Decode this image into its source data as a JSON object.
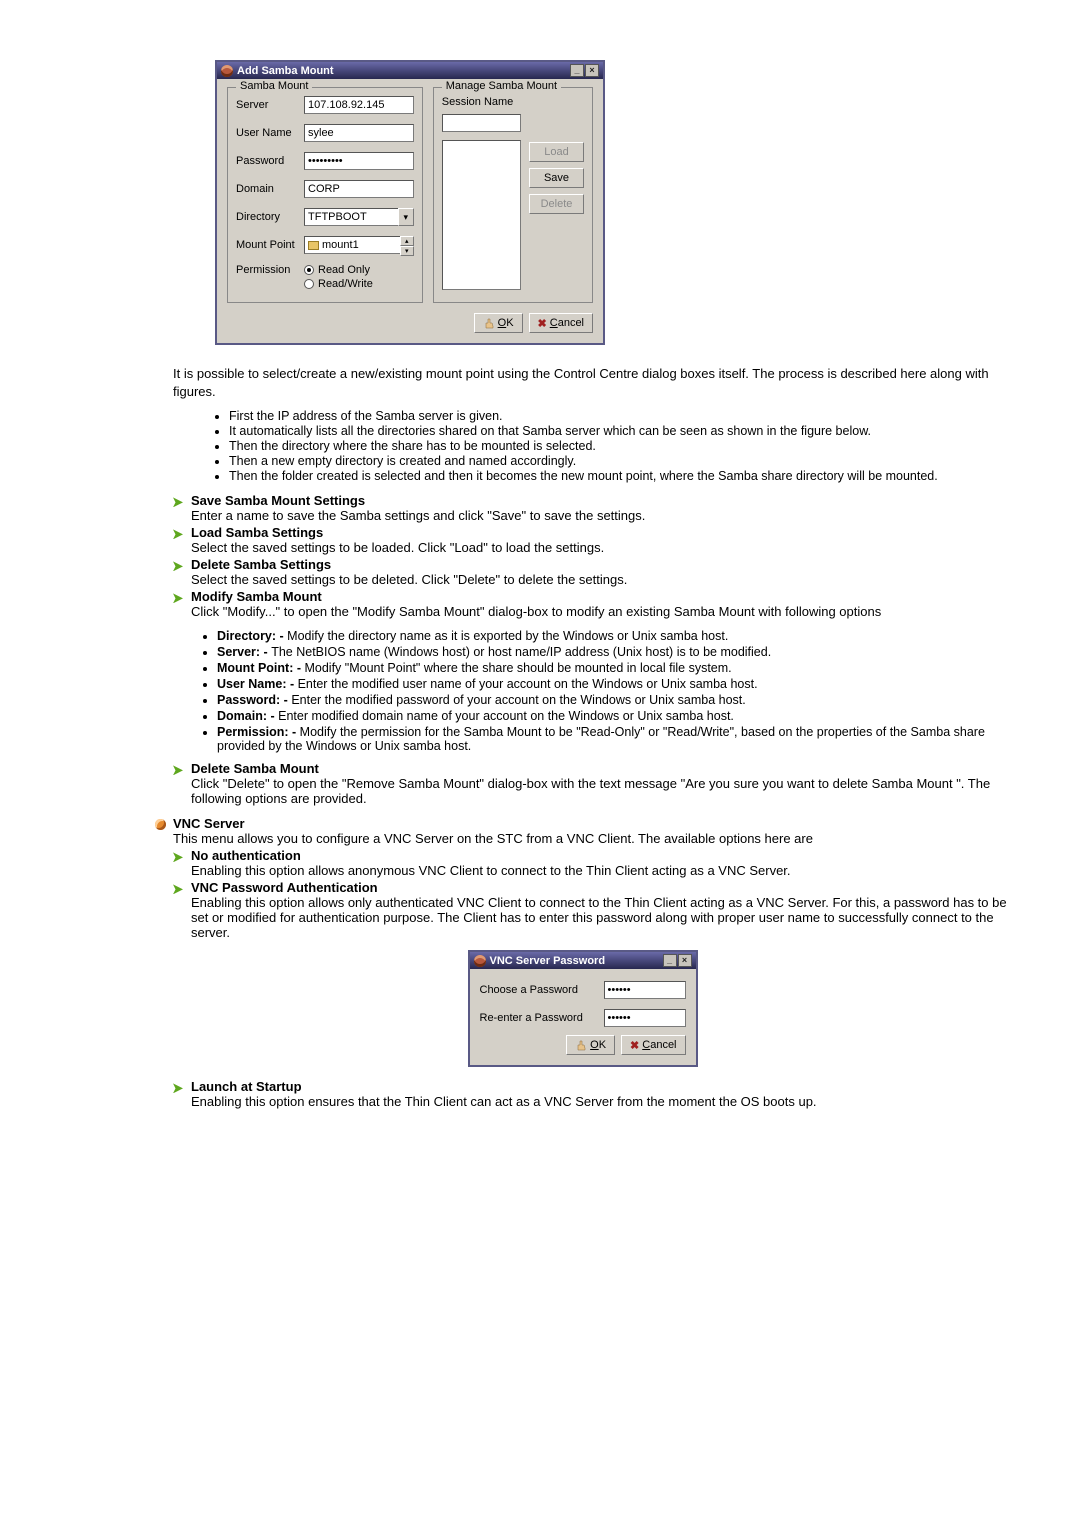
{
  "dialog1": {
    "title": "Add Samba Mount",
    "group_left_title": "Samba Mount",
    "group_right_title": "Manage Samba Mount",
    "labels": {
      "server": "Server",
      "username": "User Name",
      "password": "Password",
      "domain": "Domain",
      "directory": "Directory",
      "mountpoint": "Mount Point",
      "permission": "Permission",
      "session_name": "Session Name"
    },
    "values": {
      "server": "107.108.92.145",
      "username": "sylee",
      "password": "•••••••••",
      "domain": "CORP",
      "directory": "TFTPBOOT",
      "mountpoint": "mount1"
    },
    "radios": {
      "readonly": "Read Only",
      "readwrite": "Read/Write"
    },
    "buttons": {
      "load": "Load",
      "save": "Save",
      "delete": "Delete",
      "ok": "OK",
      "cancel": "Cancel"
    }
  },
  "doc_intro": "It is possible to select/create a new/existing mount point using the Control Centre dialog boxes itself. The process is described here along with figures.",
  "steps": [
    "First the IP address of the Samba server is given.",
    "It automatically lists all the directories shared on that Samba server which can be seen as shown in the figure below.",
    "Then the directory where the share has to be mounted is selected.",
    "Then a new empty directory is created and named accordingly.",
    "Then the folder created is selected and then it becomes the new mount point, where the Samba share directory will be mounted."
  ],
  "sections": {
    "save": {
      "title": "Save Samba Mount Settings",
      "body": "Enter a name to save the Samba settings and click \"Save\" to save the settings."
    },
    "load": {
      "title": "Load Samba Settings",
      "body": "Select the saved settings to be loaded. Click \"Load\" to load the settings."
    },
    "delset": {
      "title": "Delete Samba Settings",
      "body": "Select the saved settings to be deleted. Click \"Delete\" to delete the settings."
    },
    "modify": {
      "title": "Modify Samba Mount",
      "body": "Click \"Modify...\" to open the \"Modify Samba Mount\" dialog-box to modify an existing Samba Mount with following options"
    },
    "delmount": {
      "title": "Delete Samba Mount",
      "body": "Click \"Delete\" to open the \"Remove Samba Mount\" dialog-box with the text message \"Are you sure you want to delete Samba Mount \". The following options are provided."
    }
  },
  "modify_items": [
    {
      "label": "Directory: - ",
      "text": "Modify the directory name as it is exported by the Windows or Unix samba host."
    },
    {
      "label": "Server: - ",
      "text": "The NetBIOS name (Windows host) or host name/IP address (Unix host) is to be modified."
    },
    {
      "label": "Mount Point: - ",
      "text": "Modify \"Mount Point\" where the share should be mounted in local file system."
    },
    {
      "label": "User Name: - ",
      "text": "Enter the modified user name of your account on the Windows or Unix samba host."
    },
    {
      "label": "Password: - ",
      "text": "Enter the modified password of your account on the Windows or Unix samba host."
    },
    {
      "label": "Domain: - ",
      "text": "Enter modified domain name of your account on the Windows or Unix samba host."
    },
    {
      "label": "Permission: - ",
      "text": "Modify the permission for the Samba Mount to be \"Read-Only\" or \"Read/Write\", based on the properties of the Samba share provided by the Windows or Unix samba host."
    }
  ],
  "vnc": {
    "title": "VNC Server",
    "intro": "This menu allows you to configure a VNC Server on the STC from a VNC Client. The available options here are",
    "noauth": {
      "title": "No authentication",
      "body": "Enabling this option allows anonymous VNC Client to connect to the Thin Client acting as a VNC Server."
    },
    "pwauth": {
      "title": "VNC Password Authentication",
      "body": "Enabling this option allows only authenticated VNC Client to connect to the Thin Client acting as a VNC Server. For this, a password has to be set or modified for authentication purpose. The Client has to enter this password along with proper user name to successfully connect to the server."
    },
    "launch": {
      "title": "Launch at Startup",
      "body": "Enabling this option ensures that the Thin Client can act as a VNC Server from the moment the OS boots up."
    }
  },
  "dialog2": {
    "title": "VNC Server Password",
    "labels": {
      "choose": "Choose a Password",
      "reenter": "Re-enter a Password"
    },
    "values": {
      "choose": "••••••",
      "reenter": "••••••"
    },
    "buttons": {
      "ok": "OK",
      "cancel": "Cancel"
    }
  }
}
